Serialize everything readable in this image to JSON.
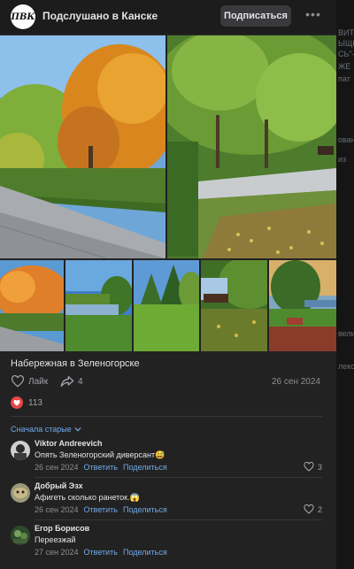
{
  "header": {
    "group_name": "Подслушано в Канске",
    "avatar_text": "ПВК",
    "subscribe_label": "Подписаться",
    "more_glyph": "•••"
  },
  "post": {
    "caption": "Набережная в Зеленогорске",
    "like_label": "Лайк",
    "share_count": "4",
    "date": "26 сен 2024",
    "reactions_count": "113"
  },
  "comments_section": {
    "sort_label": "Сначала старые"
  },
  "comments": [
    {
      "author": "Viktor Andreevich",
      "text": "Опять Зеленогорский диверсант😅",
      "date": "26 сен 2024",
      "reply": "Ответить",
      "share": "Поделиться",
      "likes": "3"
    },
    {
      "author": "Добрый Эзх",
      "text": "Афигеть сколько ранеток.😱",
      "date": "26 сен 2024",
      "reply": "Ответить",
      "share": "Поделиться",
      "likes": "2"
    },
    {
      "author": "Егор Борисов",
      "text": "Переезжай",
      "date": "27 сен 2024",
      "reply": "Ответить",
      "share": "Поделиться",
      "likes": ""
    }
  ],
  "backdrop_fragments": [
    "ВИТ",
    "ЫЩЬ",
    "СЬ\"–",
    "ЖЕ",
    "пат",
    "ован",
    "из",
    "вели",
    "лекс"
  ],
  "colors": {
    "card": "#222222",
    "header": "#1c1c1c",
    "link": "#71aaeb",
    "reaction_heart": "#e64646",
    "subscribe_button": "#3a3a3c"
  },
  "icons": [
    "more-icon",
    "heart-outline-icon",
    "share-icon",
    "heart-filled-icon",
    "chevron-down-icon"
  ]
}
